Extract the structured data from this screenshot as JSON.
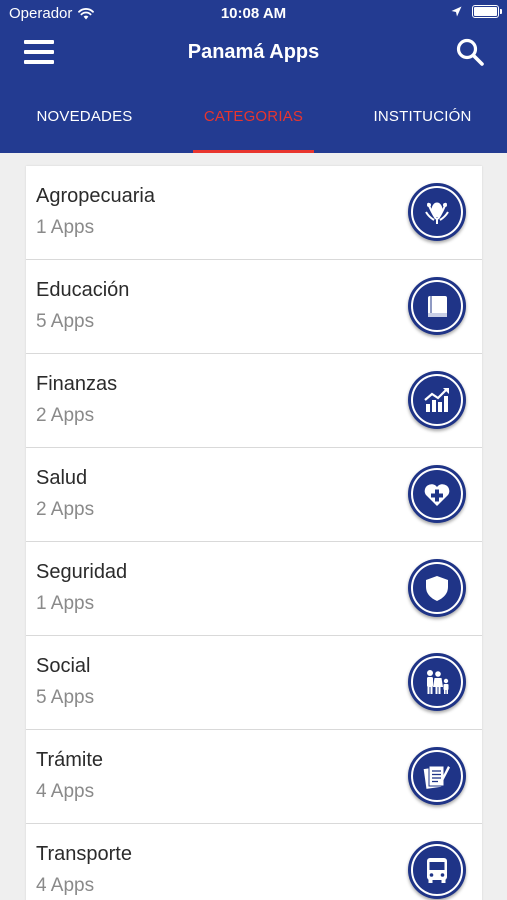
{
  "status_bar": {
    "carrier": "Operador",
    "time": "10:08 AM"
  },
  "nav": {
    "title": "Panamá Apps"
  },
  "tabs": [
    {
      "label": "NOVEDADES",
      "active": false
    },
    {
      "label": "CATEGORIAS",
      "active": true
    },
    {
      "label": "INSTITUCIÓN",
      "active": false
    }
  ],
  "categories": [
    {
      "name": "Agropecuaria",
      "count": "1 Apps",
      "icon": "agriculture-icon"
    },
    {
      "name": "Educación",
      "count": "5 Apps",
      "icon": "book-icon"
    },
    {
      "name": "Finanzas",
      "count": "2 Apps",
      "icon": "chart-icon"
    },
    {
      "name": "Salud",
      "count": "2 Apps",
      "icon": "heart-plus-icon"
    },
    {
      "name": "Seguridad",
      "count": "1 Apps",
      "icon": "shield-icon"
    },
    {
      "name": "Social",
      "count": "5 Apps",
      "icon": "family-icon"
    },
    {
      "name": "Trámite",
      "count": "4 Apps",
      "icon": "documents-icon"
    },
    {
      "name": "Transporte",
      "count": "4 Apps",
      "icon": "bus-icon"
    }
  ],
  "colors": {
    "primary": "#233b91",
    "accent": "#e8352e",
    "icon_bg": "#1f3487"
  }
}
